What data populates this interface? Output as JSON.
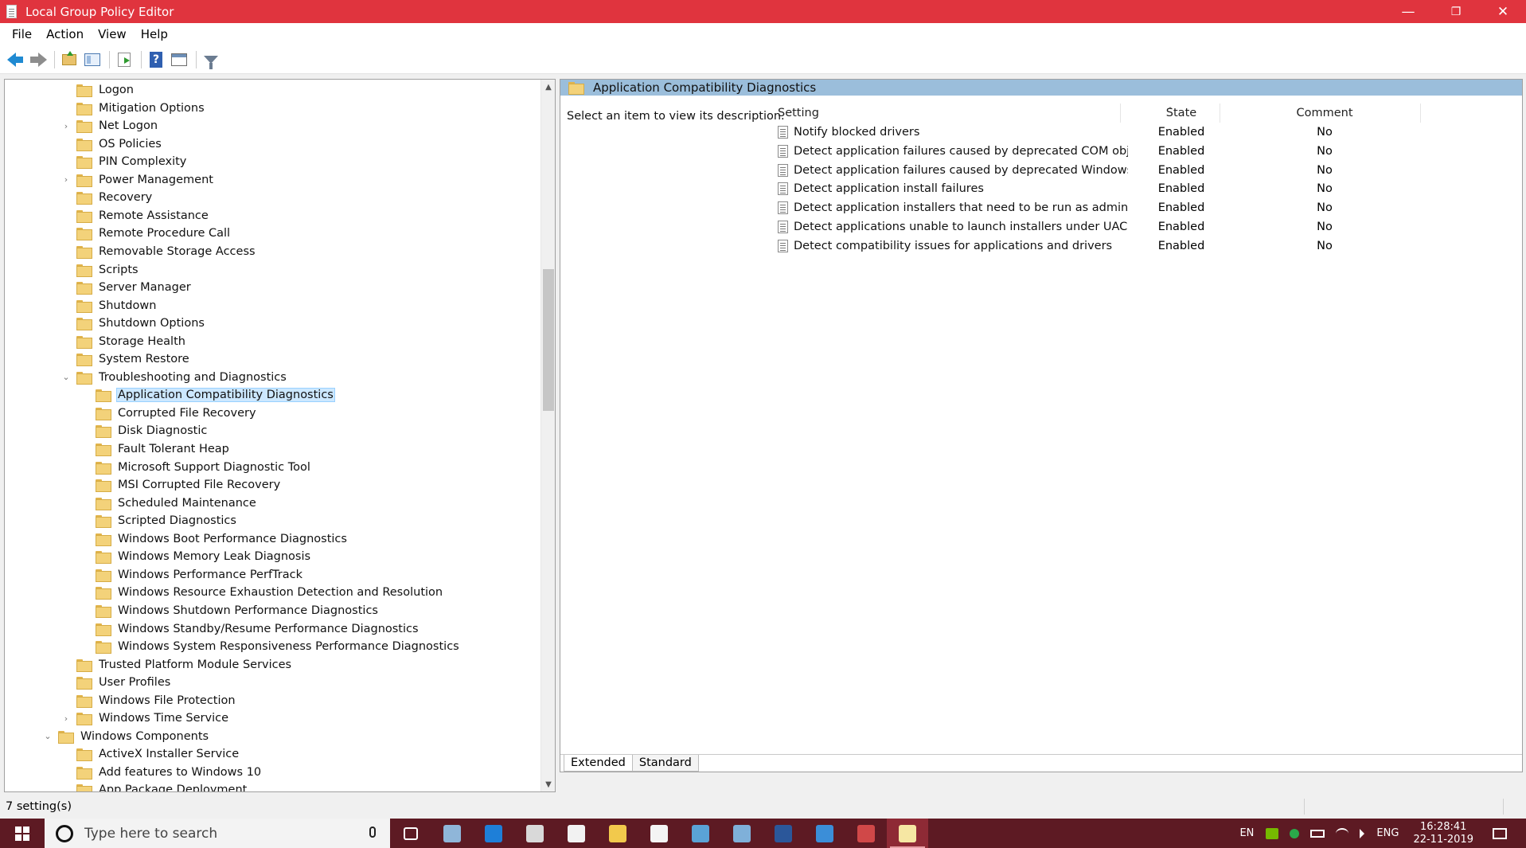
{
  "window": {
    "title": "Local Group Policy Editor",
    "controls": {
      "minimize": "—",
      "restore": "❐",
      "close": "✕"
    }
  },
  "menu": [
    "File",
    "Action",
    "View",
    "Help"
  ],
  "toolbar": {
    "buttons": [
      "back-icon",
      "forward-icon",
      "up-folder-icon",
      "show-hide-tree-icon",
      "export-list-icon",
      "help-icon",
      "properties-icon",
      "filter-icon"
    ]
  },
  "tree": {
    "items": [
      {
        "label": "Logon",
        "level": 2,
        "expander": "",
        "selected": false
      },
      {
        "label": "Mitigation Options",
        "level": 2,
        "expander": "",
        "selected": false
      },
      {
        "label": "Net Logon",
        "level": 2,
        "expander": "›",
        "selected": false
      },
      {
        "label": "OS Policies",
        "level": 2,
        "expander": "",
        "selected": false
      },
      {
        "label": "PIN Complexity",
        "level": 2,
        "expander": "",
        "selected": false
      },
      {
        "label": "Power Management",
        "level": 2,
        "expander": "›",
        "selected": false
      },
      {
        "label": "Recovery",
        "level": 2,
        "expander": "",
        "selected": false
      },
      {
        "label": "Remote Assistance",
        "level": 2,
        "expander": "",
        "selected": false
      },
      {
        "label": "Remote Procedure Call",
        "level": 2,
        "expander": "",
        "selected": false
      },
      {
        "label": "Removable Storage Access",
        "level": 2,
        "expander": "",
        "selected": false
      },
      {
        "label": "Scripts",
        "level": 2,
        "expander": "",
        "selected": false
      },
      {
        "label": "Server Manager",
        "level": 2,
        "expander": "",
        "selected": false
      },
      {
        "label": "Shutdown",
        "level": 2,
        "expander": "",
        "selected": false
      },
      {
        "label": "Shutdown Options",
        "level": 2,
        "expander": "",
        "selected": false
      },
      {
        "label": "Storage Health",
        "level": 2,
        "expander": "",
        "selected": false
      },
      {
        "label": "System Restore",
        "level": 2,
        "expander": "",
        "selected": false
      },
      {
        "label": "Troubleshooting and Diagnostics",
        "level": 2,
        "expander": "⌄",
        "selected": false
      },
      {
        "label": "Application Compatibility Diagnostics",
        "level": 3,
        "expander": "",
        "selected": true
      },
      {
        "label": "Corrupted File Recovery",
        "level": 3,
        "expander": "",
        "selected": false
      },
      {
        "label": "Disk Diagnostic",
        "level": 3,
        "expander": "",
        "selected": false
      },
      {
        "label": "Fault Tolerant Heap",
        "level": 3,
        "expander": "",
        "selected": false
      },
      {
        "label": "Microsoft Support Diagnostic Tool",
        "level": 3,
        "expander": "",
        "selected": false
      },
      {
        "label": "MSI Corrupted File Recovery",
        "level": 3,
        "expander": "",
        "selected": false
      },
      {
        "label": "Scheduled Maintenance",
        "level": 3,
        "expander": "",
        "selected": false
      },
      {
        "label": "Scripted Diagnostics",
        "level": 3,
        "expander": "",
        "selected": false
      },
      {
        "label": "Windows Boot Performance Diagnostics",
        "level": 3,
        "expander": "",
        "selected": false
      },
      {
        "label": "Windows Memory Leak Diagnosis",
        "level": 3,
        "expander": "",
        "selected": false
      },
      {
        "label": "Windows Performance PerfTrack",
        "level": 3,
        "expander": "",
        "selected": false
      },
      {
        "label": "Windows Resource Exhaustion Detection and Resolution",
        "level": 3,
        "expander": "",
        "selected": false
      },
      {
        "label": "Windows Shutdown Performance Diagnostics",
        "level": 3,
        "expander": "",
        "selected": false
      },
      {
        "label": "Windows Standby/Resume Performance Diagnostics",
        "level": 3,
        "expander": "",
        "selected": false
      },
      {
        "label": "Windows System Responsiveness Performance Diagnostics",
        "level": 3,
        "expander": "",
        "selected": false
      },
      {
        "label": "Trusted Platform Module Services",
        "level": 2,
        "expander": "",
        "selected": false
      },
      {
        "label": "User Profiles",
        "level": 2,
        "expander": "",
        "selected": false
      },
      {
        "label": "Windows File Protection",
        "level": 2,
        "expander": "",
        "selected": false
      },
      {
        "label": "Windows Time Service",
        "level": 2,
        "expander": "›",
        "selected": false
      },
      {
        "label": "Windows Components",
        "level": 1,
        "expander": "⌄",
        "selected": false
      },
      {
        "label": "ActiveX Installer Service",
        "level": 2,
        "expander": "",
        "selected": false
      },
      {
        "label": "Add features to Windows 10",
        "level": 2,
        "expander": "",
        "selected": false
      },
      {
        "label": "App Package Deployment",
        "level": 2,
        "expander": "",
        "selected": false
      }
    ]
  },
  "details": {
    "header": "Application Compatibility Diagnostics",
    "description": "Select an item to view its description.",
    "columns": {
      "setting": "Setting",
      "state": "State",
      "comment": "Comment"
    },
    "rows": [
      {
        "setting": "Notify blocked drivers",
        "state": "Enabled",
        "comment": "No"
      },
      {
        "setting": "Detect application failures caused by deprecated COM objects",
        "state": "Enabled",
        "comment": "No"
      },
      {
        "setting": "Detect application failures caused by deprecated Windows DL...",
        "state": "Enabled",
        "comment": "No"
      },
      {
        "setting": "Detect application install failures",
        "state": "Enabled",
        "comment": "No"
      },
      {
        "setting": "Detect application installers that need to be run as administr...",
        "state": "Enabled",
        "comment": "No"
      },
      {
        "setting": "Detect applications unable to launch installers under UAC",
        "state": "Enabled",
        "comment": "No"
      },
      {
        "setting": "Detect compatibility issues for applications and drivers",
        "state": "Enabled",
        "comment": "No"
      }
    ],
    "tabs": [
      "Extended",
      "Standard"
    ]
  },
  "status": {
    "text": "7 setting(s)"
  },
  "taskbar": {
    "search_placeholder": "Type here to search",
    "apps": [
      {
        "name": "task-view-icon",
        "color": "#5d1a23"
      },
      {
        "name": "notepad-icon",
        "color": "#8fb6d9"
      },
      {
        "name": "edge-icon",
        "color": "#1e7fd8"
      },
      {
        "name": "settings-icon",
        "color": "#d9d9d9"
      },
      {
        "name": "mail-icon",
        "color": "#f2f2f2"
      },
      {
        "name": "file-explorer-icon",
        "color": "#f2c94c"
      },
      {
        "name": "store-icon",
        "color": "#f4f4f4"
      },
      {
        "name": "control-panel-icon",
        "color": "#5aa3d6"
      },
      {
        "name": "app-icon",
        "color": "#7fb0d9"
      },
      {
        "name": "word-icon",
        "color": "#2b579a"
      },
      {
        "name": "tool-icon",
        "color": "#3b8ed8"
      },
      {
        "name": "network-icon",
        "color": "#d04848"
      },
      {
        "name": "group-policy-icon",
        "color": "#f6e7a3"
      }
    ],
    "tray": {
      "lang1": "EN",
      "lang2": "ENG",
      "time": "16:28:41",
      "date": "22-11-2019"
    }
  },
  "colors": {
    "titlebar": "#e0343e",
    "taskbar": "#5d1a23",
    "header": "#9bbedb",
    "selection": "#cce8ff"
  }
}
